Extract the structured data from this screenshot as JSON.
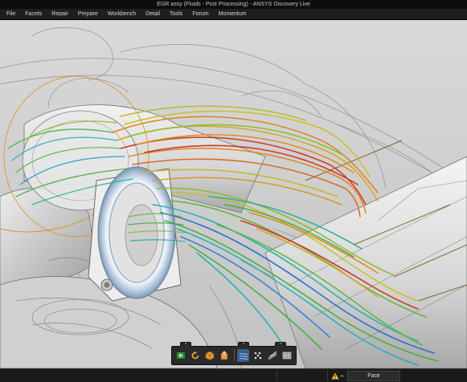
{
  "window": {
    "title": "EGR assy (Fluids - Post Processing) - ANSYS Discovery Live"
  },
  "menu": {
    "items": [
      "File",
      "Facets",
      "Repair",
      "Prepare",
      "Workbench",
      "Detail",
      "Tools",
      "Forum",
      "Momentum"
    ]
  },
  "toolbar": {
    "buttons": [
      {
        "icon": "play-icon",
        "color": "#3fb33f"
      },
      {
        "icon": "refresh-icon",
        "color": "#e8a33a"
      },
      {
        "icon": "cube-icon",
        "color": "#e8983a"
      },
      {
        "icon": "box-export-icon",
        "color": "#e89a4a"
      },
      {
        "icon": "streamlines-icon",
        "color": "#8fc2ff",
        "active": true
      },
      {
        "icon": "particles-icon",
        "color": "#dddddd"
      },
      {
        "icon": "flow-lines-icon",
        "color": "#dddddd"
      },
      {
        "icon": "surface-plot-icon",
        "color": "#bbbbbb"
      }
    ]
  },
  "status": {
    "warning_icon": "warning-icon",
    "warning_color": "#f0c020",
    "mode": "Face"
  },
  "colors": {
    "stream_red": "#d0301c",
    "stream_orange": "#e08a1a",
    "stream_yellow": "#c9c022",
    "stream_green": "#3fae3c",
    "stream_cyan": "#1fb0b8",
    "stream_blue": "#1f6fd0",
    "flange_ring": "#c6d8ef"
  }
}
